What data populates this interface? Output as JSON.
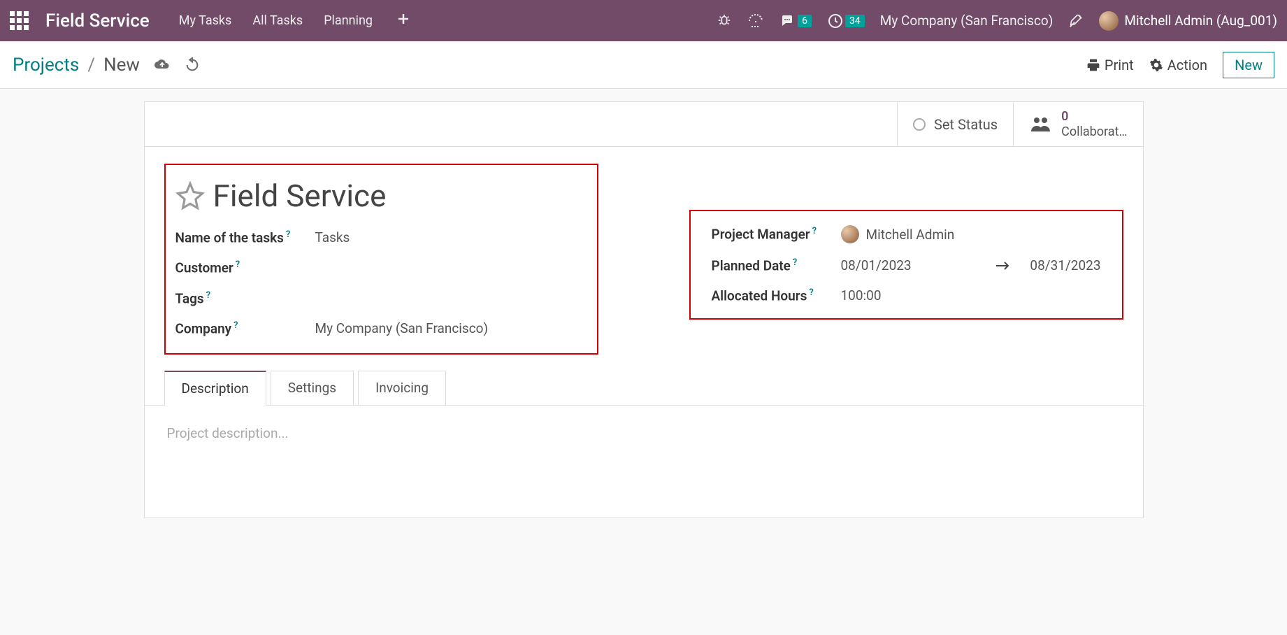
{
  "navbar": {
    "brand": "Field Service",
    "menu": [
      "My Tasks",
      "All Tasks",
      "Planning"
    ],
    "chat_badge": "6",
    "clock_badge": "34",
    "company": "My Company (San Francisco)",
    "user": "Mitchell Admin (Aug_001)"
  },
  "breadcrumb": {
    "link": "Projects",
    "current": "New",
    "print": "Print",
    "action": "Action",
    "new_btn": "New"
  },
  "statusbar": {
    "set_status": "Set Status",
    "collab_count": "0",
    "collab_label": "Collaborat…"
  },
  "form": {
    "title": "Field Service",
    "left": {
      "name_label": "Name of the tasks",
      "name_value": "Tasks",
      "customer_label": "Customer",
      "customer_value": "",
      "tags_label": "Tags",
      "tags_value": "",
      "company_label": "Company",
      "company_value": "My Company (San Francisco)"
    },
    "right": {
      "pm_label": "Project Manager",
      "pm_value": "Mitchell Admin",
      "date_label": "Planned Date",
      "date_start": "08/01/2023",
      "date_end": "08/31/2023",
      "hours_label": "Allocated Hours",
      "hours_value": "100:00"
    }
  },
  "tabs": {
    "t1": "Description",
    "t2": "Settings",
    "t3": "Invoicing",
    "placeholder": "Project description..."
  }
}
